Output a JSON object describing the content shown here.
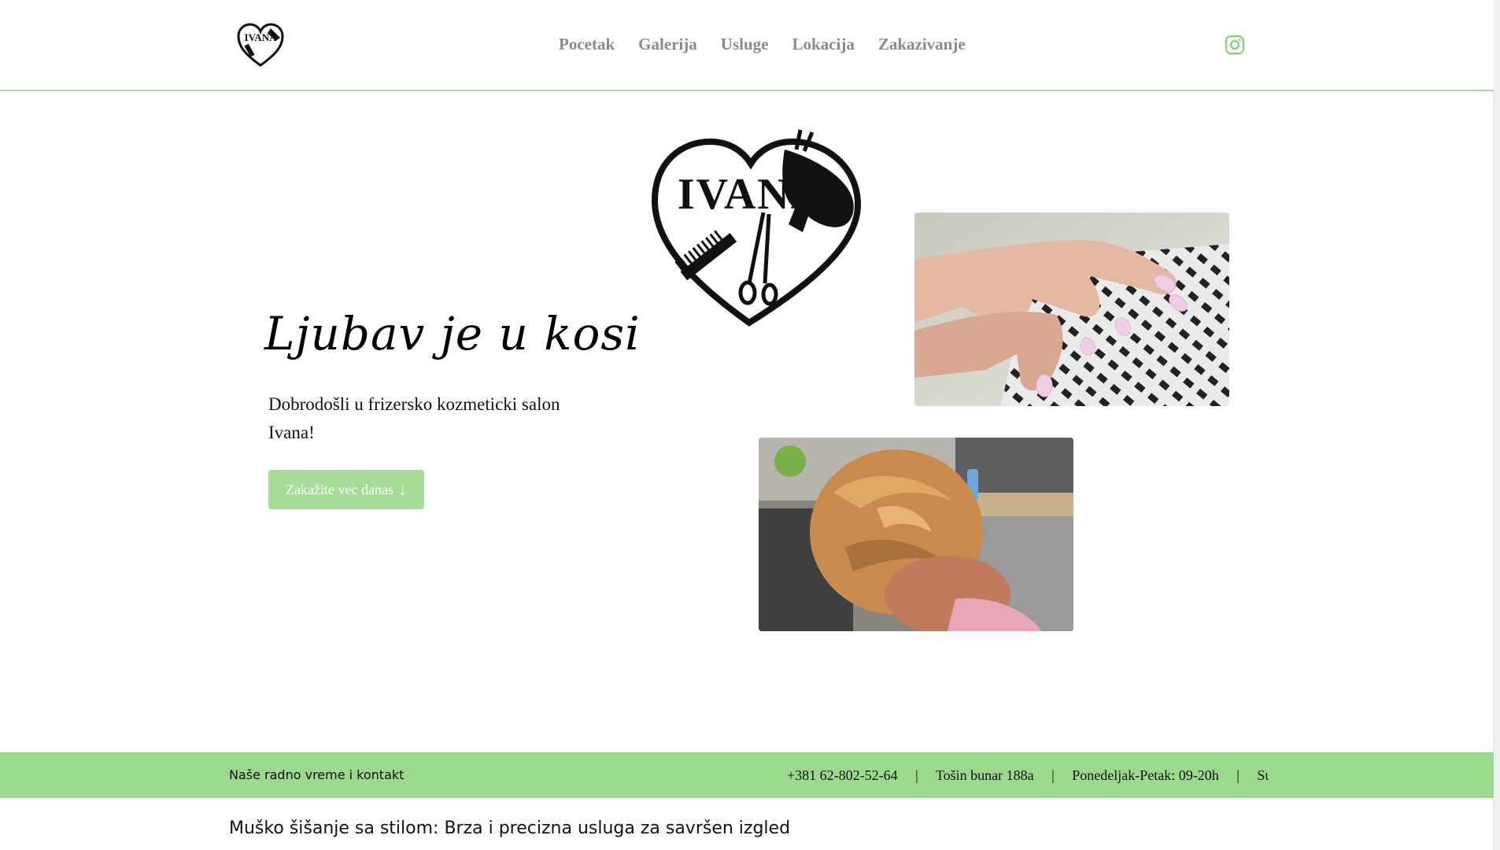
{
  "header": {
    "logo_text": "IVANA",
    "nav": [
      "Pocetak",
      "Galerija",
      "Usluge",
      "Lokacija",
      "Zakazivanje"
    ],
    "social_icon": "instagram-icon"
  },
  "hero": {
    "title": "Ljubav je u kosi",
    "text": "Dobrodošli u frizersko kozmeticki salon Ivana!",
    "cta_label": "Zakažite vec danas",
    "cta_arrow": "↓",
    "logo_text": "IVANA"
  },
  "infobar": {
    "label": "Naše radno vreme i kontakt",
    "phone": "+381 62-802-52-64",
    "address": "Tošin bunar 188a",
    "hours": "Ponedeljak-Petak: 09-20h",
    "separator": "|",
    "next": "Sul"
  },
  "section": {
    "heading": "Muško šišanje sa stilom: Brza i precizna usluga za savršen izgled"
  },
  "colors": {
    "accent": "#a4dc98",
    "bar": "#9bd98d",
    "nav_text": "#8a8a8a"
  }
}
